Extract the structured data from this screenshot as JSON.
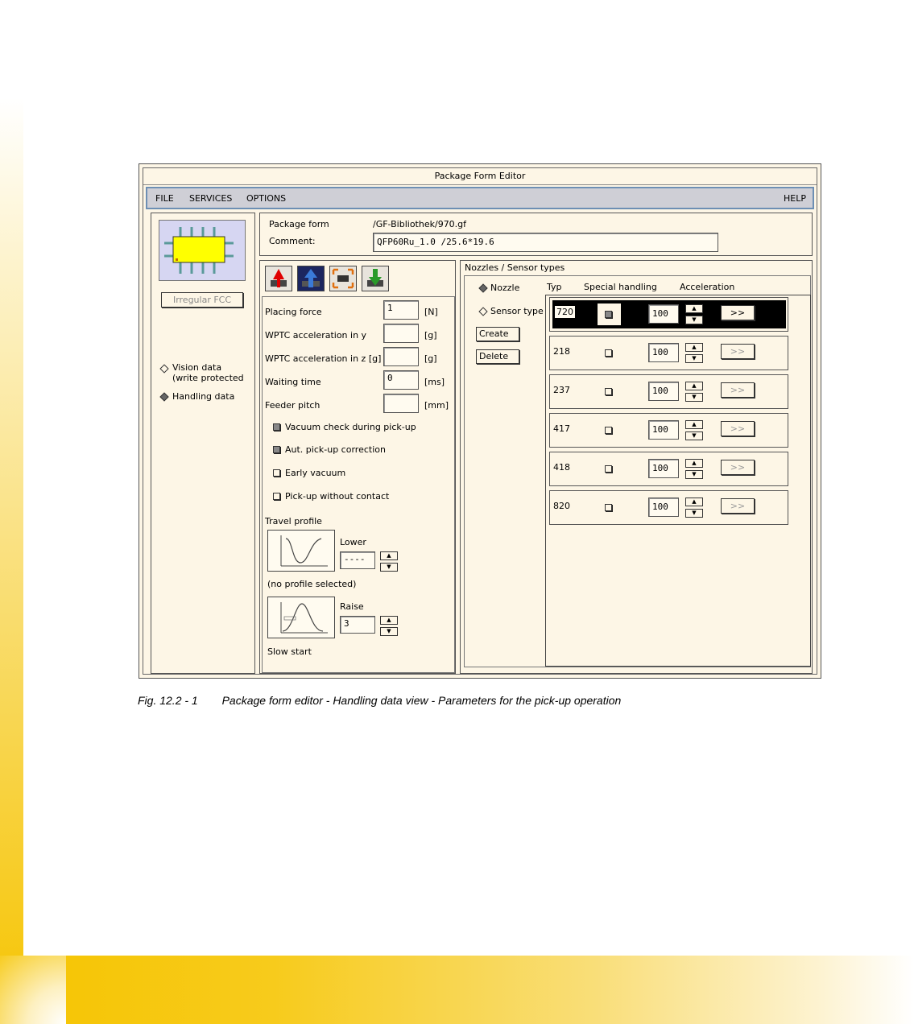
{
  "window": {
    "title": "Package Form Editor"
  },
  "menu": {
    "file": "FILE",
    "services": "SERVICES",
    "options": "OPTIONS",
    "help": "HELP"
  },
  "left_panel": {
    "package_type": "Irregular FCC",
    "views": [
      {
        "label": "Vision data",
        "sublabel": "(write protected",
        "selected": false
      },
      {
        "label": "Handling data",
        "selected": true
      }
    ]
  },
  "header": {
    "package_form_label": "Package form",
    "package_form_value": "/GF-Bibliothek/970.gf",
    "comment_label": "Comment:",
    "comment_value": "QFP60Ru_1.0 /25.6*19.6"
  },
  "toolbar": {
    "buttons": [
      {
        "icon": "red-pickup-icon"
      },
      {
        "icon": "blue-arrow-up-icon",
        "active": true
      },
      {
        "icon": "component-frame-icon"
      },
      {
        "icon": "green-place-icon"
      }
    ]
  },
  "params": {
    "placing_force": {
      "label": "Placing force",
      "value": "1",
      "unit": "[N]"
    },
    "wptc_y": {
      "label": "WPTC acceleration in y",
      "value": "",
      "unit": "[g]"
    },
    "wptc_z": {
      "label": "WPTC acceleration in z [g]",
      "value": "",
      "unit": "[g]"
    },
    "waiting_time": {
      "label": "Waiting time",
      "value": "0",
      "unit": "[ms]"
    },
    "feeder_pitch": {
      "label": "Feeder pitch",
      "value": "",
      "unit": "[mm]"
    },
    "checks": [
      {
        "label": "Vacuum check during pick-up",
        "checked": true
      },
      {
        "label": "Aut. pick-up correction",
        "checked": true
      },
      {
        "label": "Early vacuum",
        "checked": false
      },
      {
        "label": "Pick-up without contact",
        "checked": false
      }
    ],
    "travel_profile_label": "Travel profile",
    "lower": {
      "label": "Lower",
      "value": "----",
      "status": "(no profile selected)"
    },
    "raise": {
      "label": "Raise",
      "value": "3",
      "status": "Slow start"
    }
  },
  "nozzles": {
    "section_title": "Nozzles / Sensor types",
    "radio_nozzle": "Nozzle",
    "radio_sensor": "Sensor type",
    "create_label": "Create",
    "delete_label": "Delete",
    "col_typ": "Typ",
    "col_special": "Special handling",
    "col_accel": "Acceleration",
    "rows": [
      {
        "typ": "720",
        "special": true,
        "accel": "100",
        "more": ">>",
        "selected": true
      },
      {
        "typ": "218",
        "special": false,
        "accel": "100",
        "more": ">>"
      },
      {
        "typ": "237",
        "special": false,
        "accel": "100",
        "more": ">>"
      },
      {
        "typ": "417",
        "special": false,
        "accel": "100",
        "more": ">>"
      },
      {
        "typ": "418",
        "special": false,
        "accel": "100",
        "more": ">>"
      },
      {
        "typ": "820",
        "special": false,
        "accel": "100",
        "more": ">>"
      }
    ]
  },
  "caption": {
    "figure": "Fig. 12.2 - 1",
    "text": "Package form editor - Handling data view - Parameters for the pick-up operation"
  }
}
